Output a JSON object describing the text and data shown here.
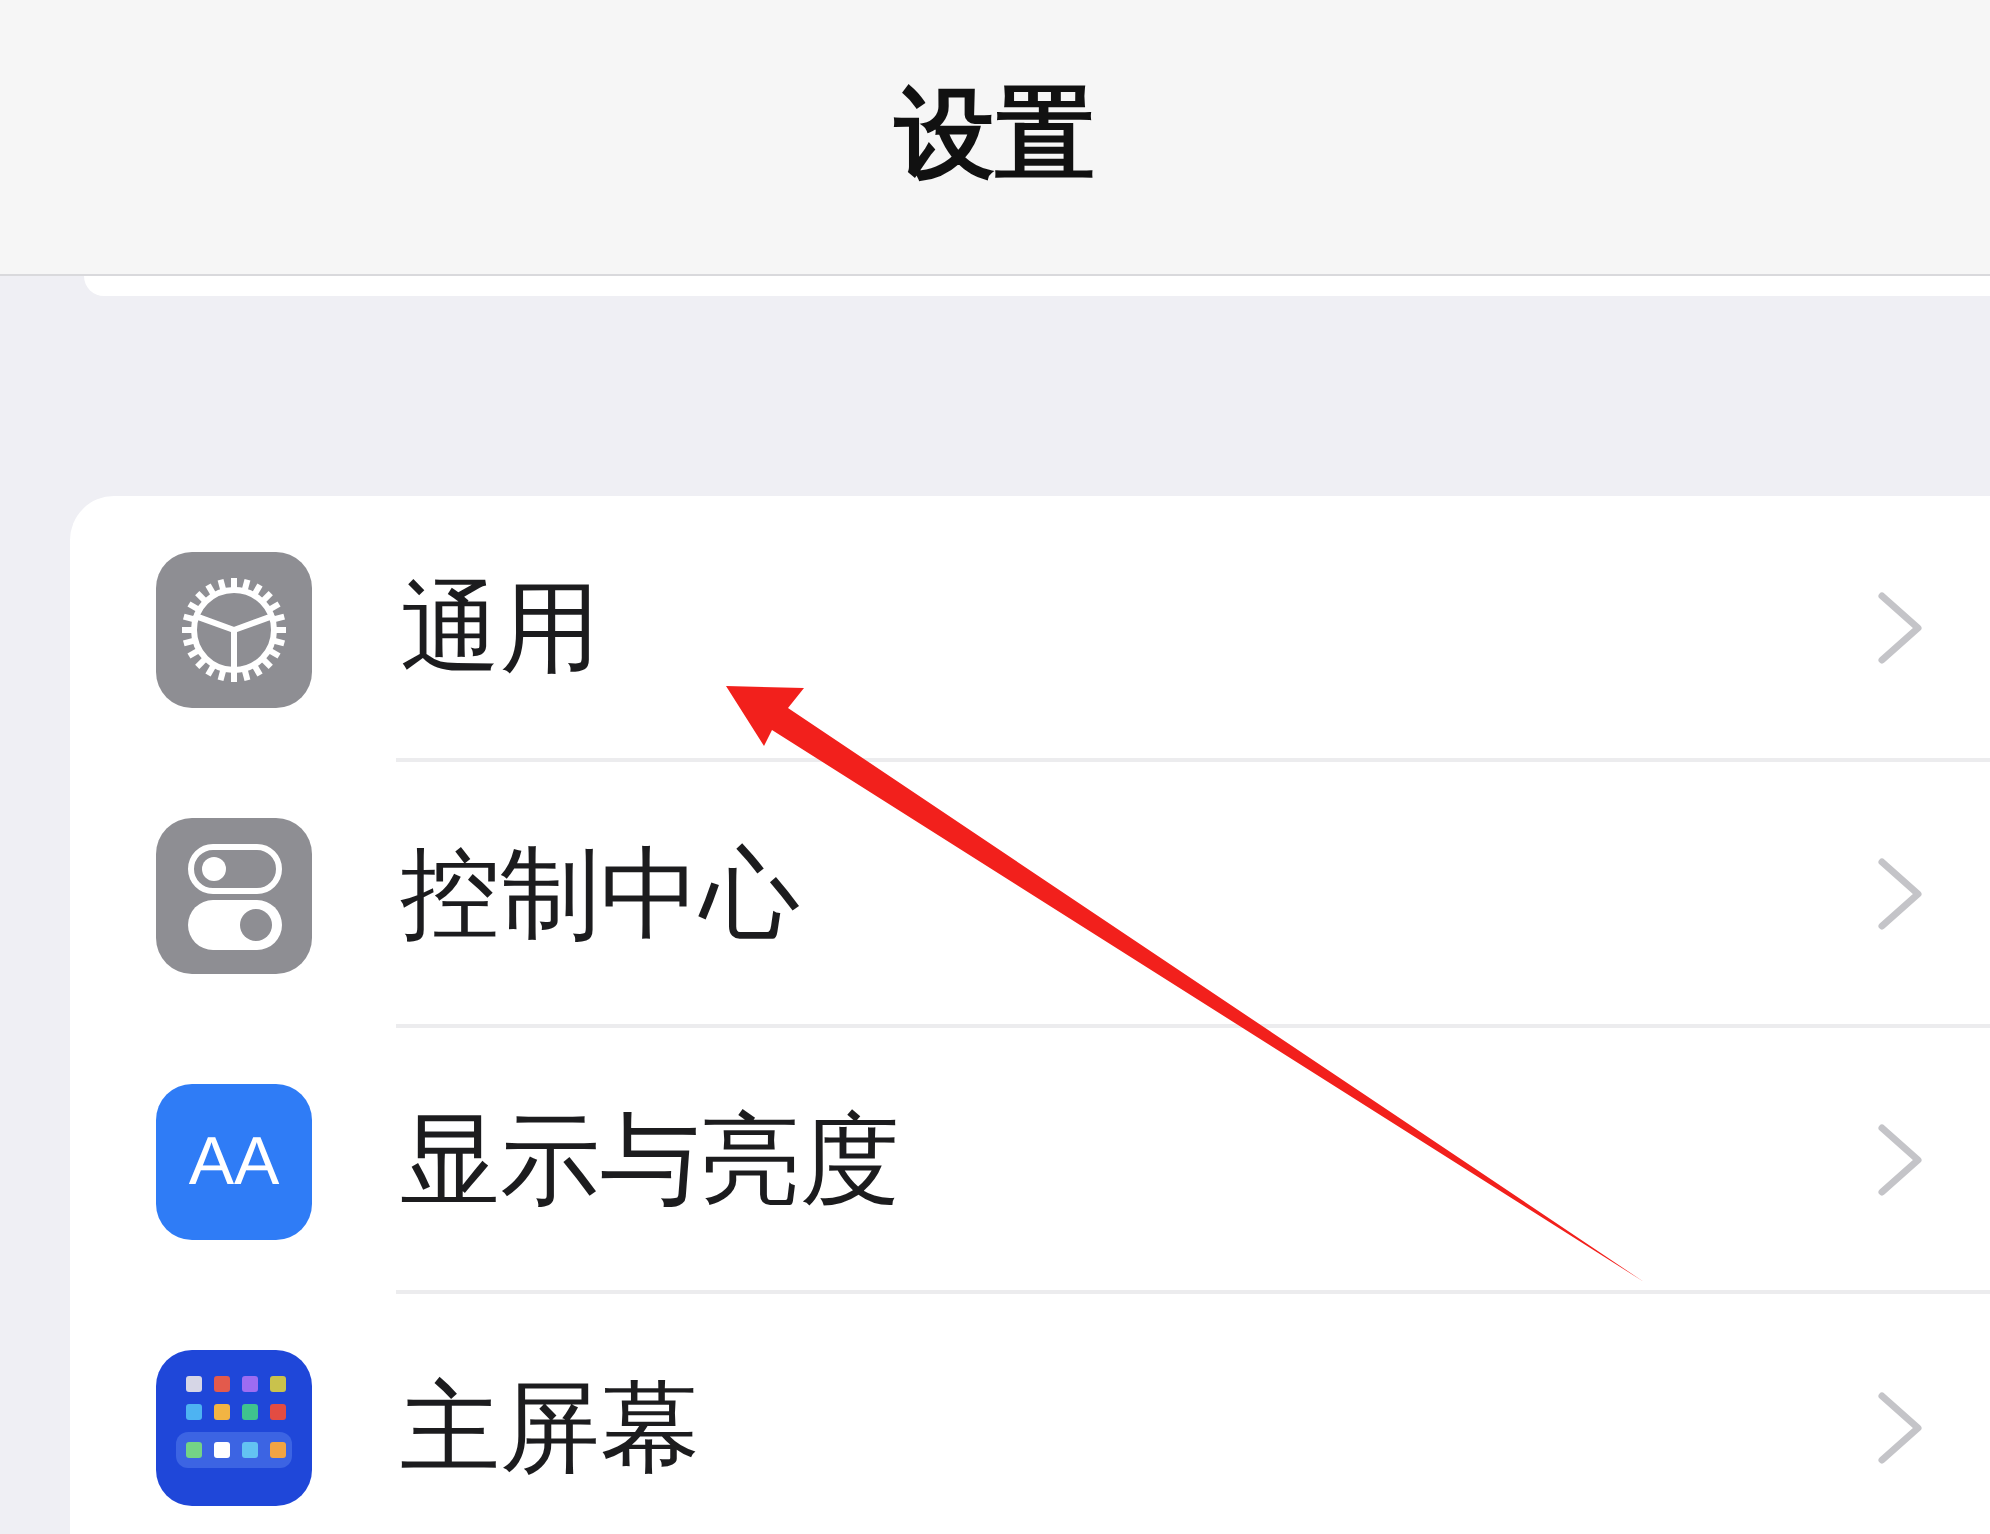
{
  "navigation_bar": {
    "title": "设置"
  },
  "settings": [
    {
      "kind": "gear",
      "label": "通用"
    },
    {
      "kind": "toggles",
      "label": "控制中心"
    },
    {
      "kind": "letters",
      "icon_text": "AA",
      "label": "显示与亮度"
    },
    {
      "kind": "apps",
      "label": "主屏幕"
    }
  ]
}
